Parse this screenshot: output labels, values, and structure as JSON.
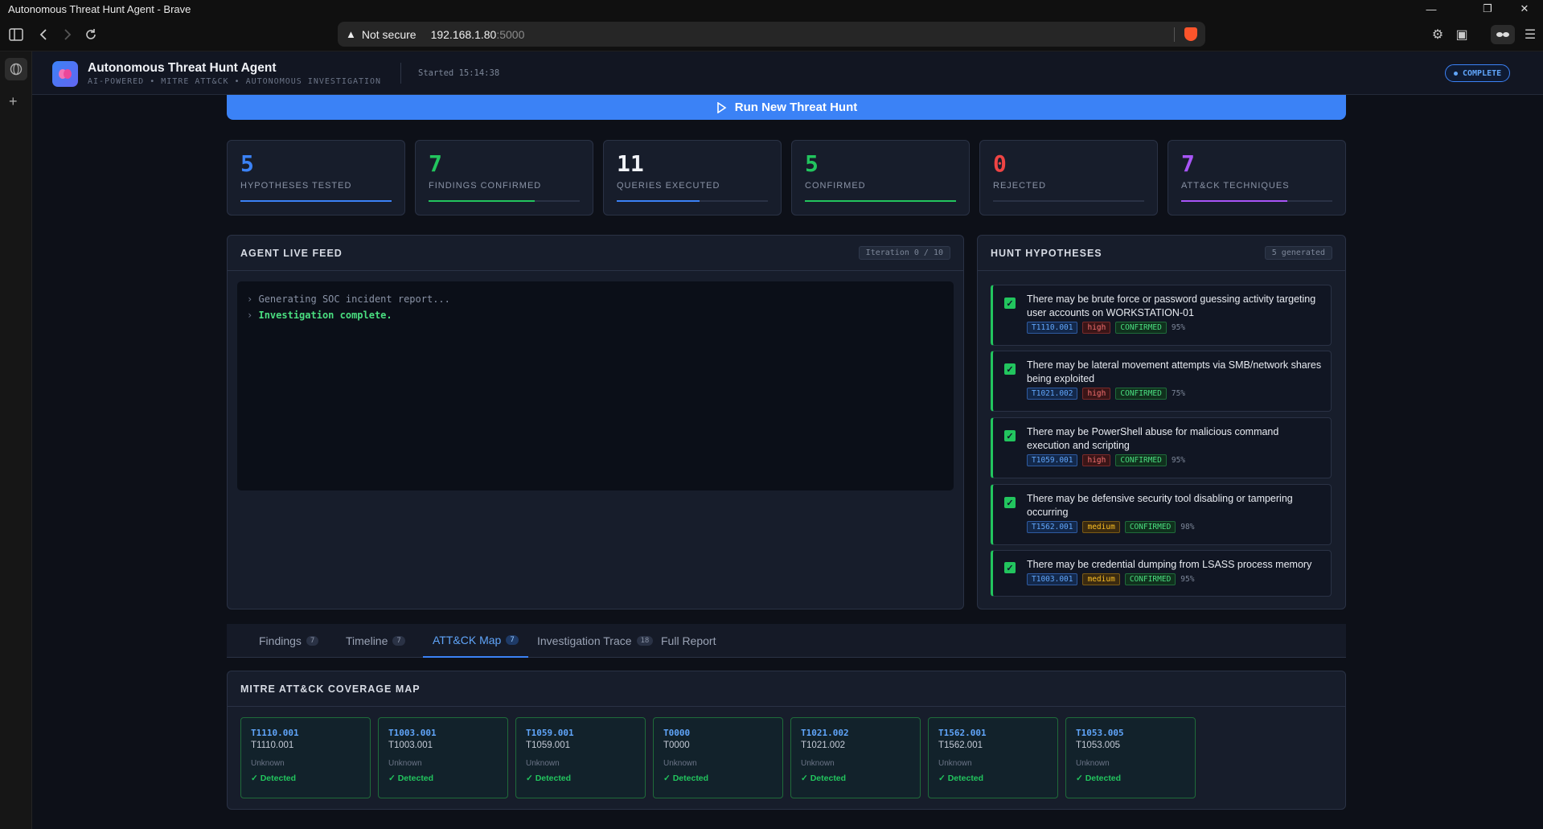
{
  "window": {
    "title": "Autonomous Threat Hunt Agent - Brave"
  },
  "browser": {
    "security_label": "Not secure",
    "url_host": "192.168.1.80",
    "url_port": ":5000"
  },
  "app": {
    "title": "Autonomous Threat Hunt Agent",
    "subtitle": "AI-POWERED • MITRE ATT&CK • AUTONOMOUS INVESTIGATION",
    "started": "Started 15:14:38",
    "status": "COMPLETE"
  },
  "run_button": {
    "label": "Run New Threat Hunt"
  },
  "stats": [
    {
      "value": "5",
      "label": "HYPOTHESES TESTED",
      "color": "#3b82f6",
      "fill": 1.0
    },
    {
      "value": "7",
      "label": "FINDINGS CONFIRMED",
      "color": "#22c55e",
      "fill": 0.7
    },
    {
      "value": "11",
      "label": "QUERIES EXECUTED",
      "color": "#3b82f6",
      "fill": 0.55
    },
    {
      "value": "5",
      "label": "CONFIRMED",
      "color": "#22c55e",
      "fill": 1.0
    },
    {
      "value": "0",
      "label": "REJECTED",
      "color": "#ef4444",
      "fill": 0
    },
    {
      "value": "7",
      "label": "ATT&CK TECHNIQUES",
      "color": "#a855f7",
      "fill": 0.7
    }
  ],
  "live_feed": {
    "title": "AGENT LIVE FEED",
    "iteration": "Iteration 0 / 10",
    "lines": [
      {
        "prefix": "›",
        "text": "Generating SOC incident report..."
      },
      {
        "prefix": "›",
        "text": "Investigation complete."
      }
    ]
  },
  "hypotheses": {
    "title": "HUNT HYPOTHESES",
    "generated": "5 generated",
    "items": [
      {
        "text": "There may be brute force or password guessing activity targeting user accounts on WORKSTATION-01",
        "technique": "T1110.001",
        "severity": "high",
        "status": "CONFIRMED",
        "confidence": "95%"
      },
      {
        "text": "There may be lateral movement attempts via SMB/network shares being exploited",
        "technique": "T1021.002",
        "severity": "high",
        "status": "CONFIRMED",
        "confidence": "75%"
      },
      {
        "text": "There may be PowerShell abuse for malicious command execution and scripting",
        "technique": "T1059.001",
        "severity": "high",
        "status": "CONFIRMED",
        "confidence": "95%"
      },
      {
        "text": "There may be defensive security tool disabling or tampering occurring",
        "technique": "T1562.001",
        "severity": "medium",
        "status": "CONFIRMED",
        "confidence": "98%"
      },
      {
        "text": "There may be credential dumping from LSASS process memory",
        "technique": "T1003.001",
        "severity": "medium",
        "status": "CONFIRMED",
        "confidence": "95%"
      }
    ]
  },
  "tabs": [
    {
      "label": "Findings",
      "count": "7"
    },
    {
      "label": "Timeline",
      "count": "7"
    },
    {
      "label": "ATT&CK Map",
      "count": "7",
      "active": true
    },
    {
      "label": "Investigation Trace",
      "count": "18"
    },
    {
      "label": "Full Report",
      "count": ""
    }
  ],
  "coverage": {
    "title": "MITRE ATT&CK COVERAGE MAP",
    "cards": [
      {
        "id": "T1110.001",
        "name": "T1110.001",
        "tactic": "Unknown",
        "status": "✓ Detected"
      },
      {
        "id": "T1003.001",
        "name": "T1003.001",
        "tactic": "Unknown",
        "status": "✓ Detected"
      },
      {
        "id": "T1059.001",
        "name": "T1059.001",
        "tactic": "Unknown",
        "status": "✓ Detected"
      },
      {
        "id": "T0000",
        "name": "T0000",
        "tactic": "Unknown",
        "status": "✓ Detected"
      },
      {
        "id": "T1021.002",
        "name": "T1021.002",
        "tactic": "Unknown",
        "status": "✓ Detected"
      },
      {
        "id": "T1562.001",
        "name": "T1562.001",
        "tactic": "Unknown",
        "status": "✓ Detected"
      },
      {
        "id": "T1053.005",
        "name": "T1053.005",
        "tactic": "Unknown",
        "status": "✓ Detected"
      }
    ]
  }
}
